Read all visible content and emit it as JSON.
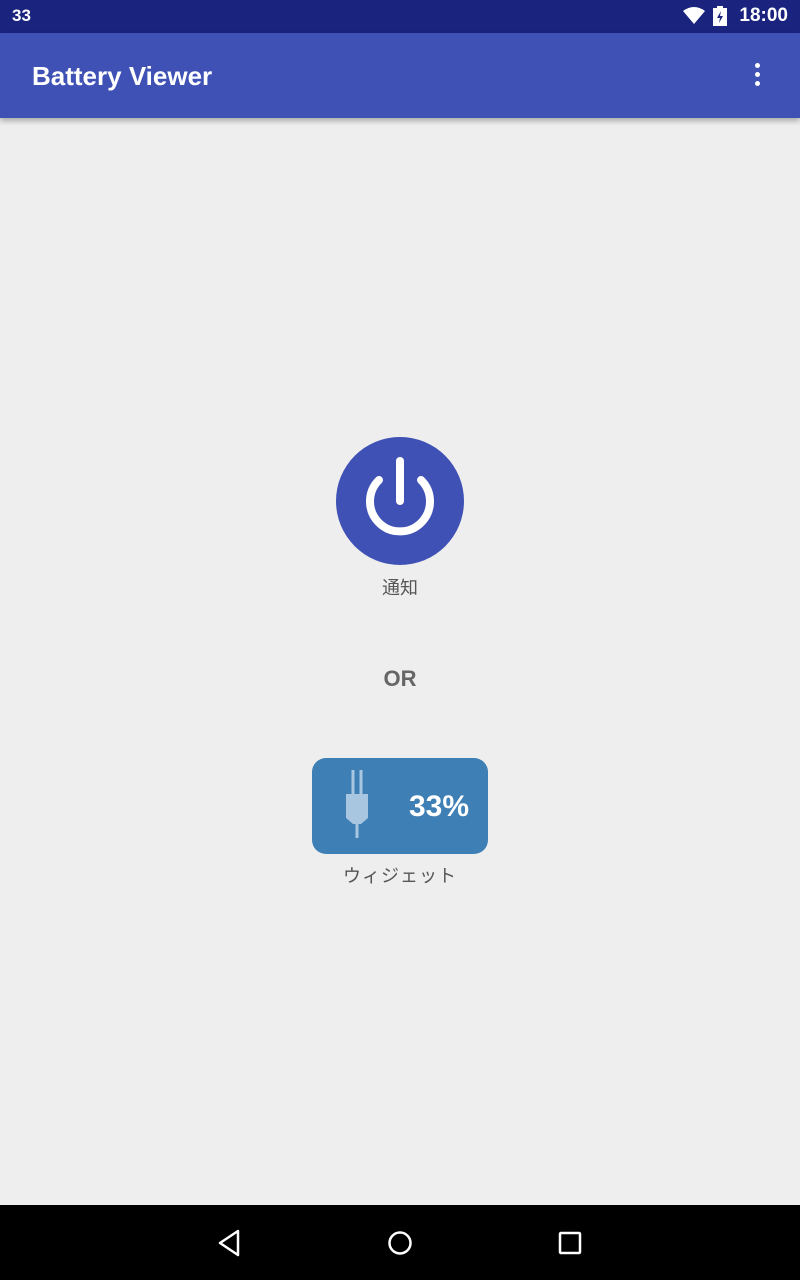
{
  "status_bar": {
    "left_text": "33",
    "time": "18:00",
    "icons": [
      "wifi-icon",
      "battery-charging-icon"
    ]
  },
  "app_bar": {
    "title": "Battery Viewer",
    "overflow_icon": "more-vert-icon"
  },
  "main": {
    "notify_button": {
      "icon": "power-icon",
      "label": "通知",
      "color": "#3f51b5"
    },
    "or_text": "OR",
    "widget_button": {
      "icon": "plug-icon",
      "percent": "33%",
      "label": "ウィジェット",
      "color": "#3e7fb5"
    }
  },
  "nav_bar": {
    "buttons": [
      "back-icon",
      "home-icon",
      "recents-icon"
    ]
  },
  "colors": {
    "status_bar": "#1a237e",
    "app_bar": "#3f51b5",
    "background": "#eeeeee"
  }
}
